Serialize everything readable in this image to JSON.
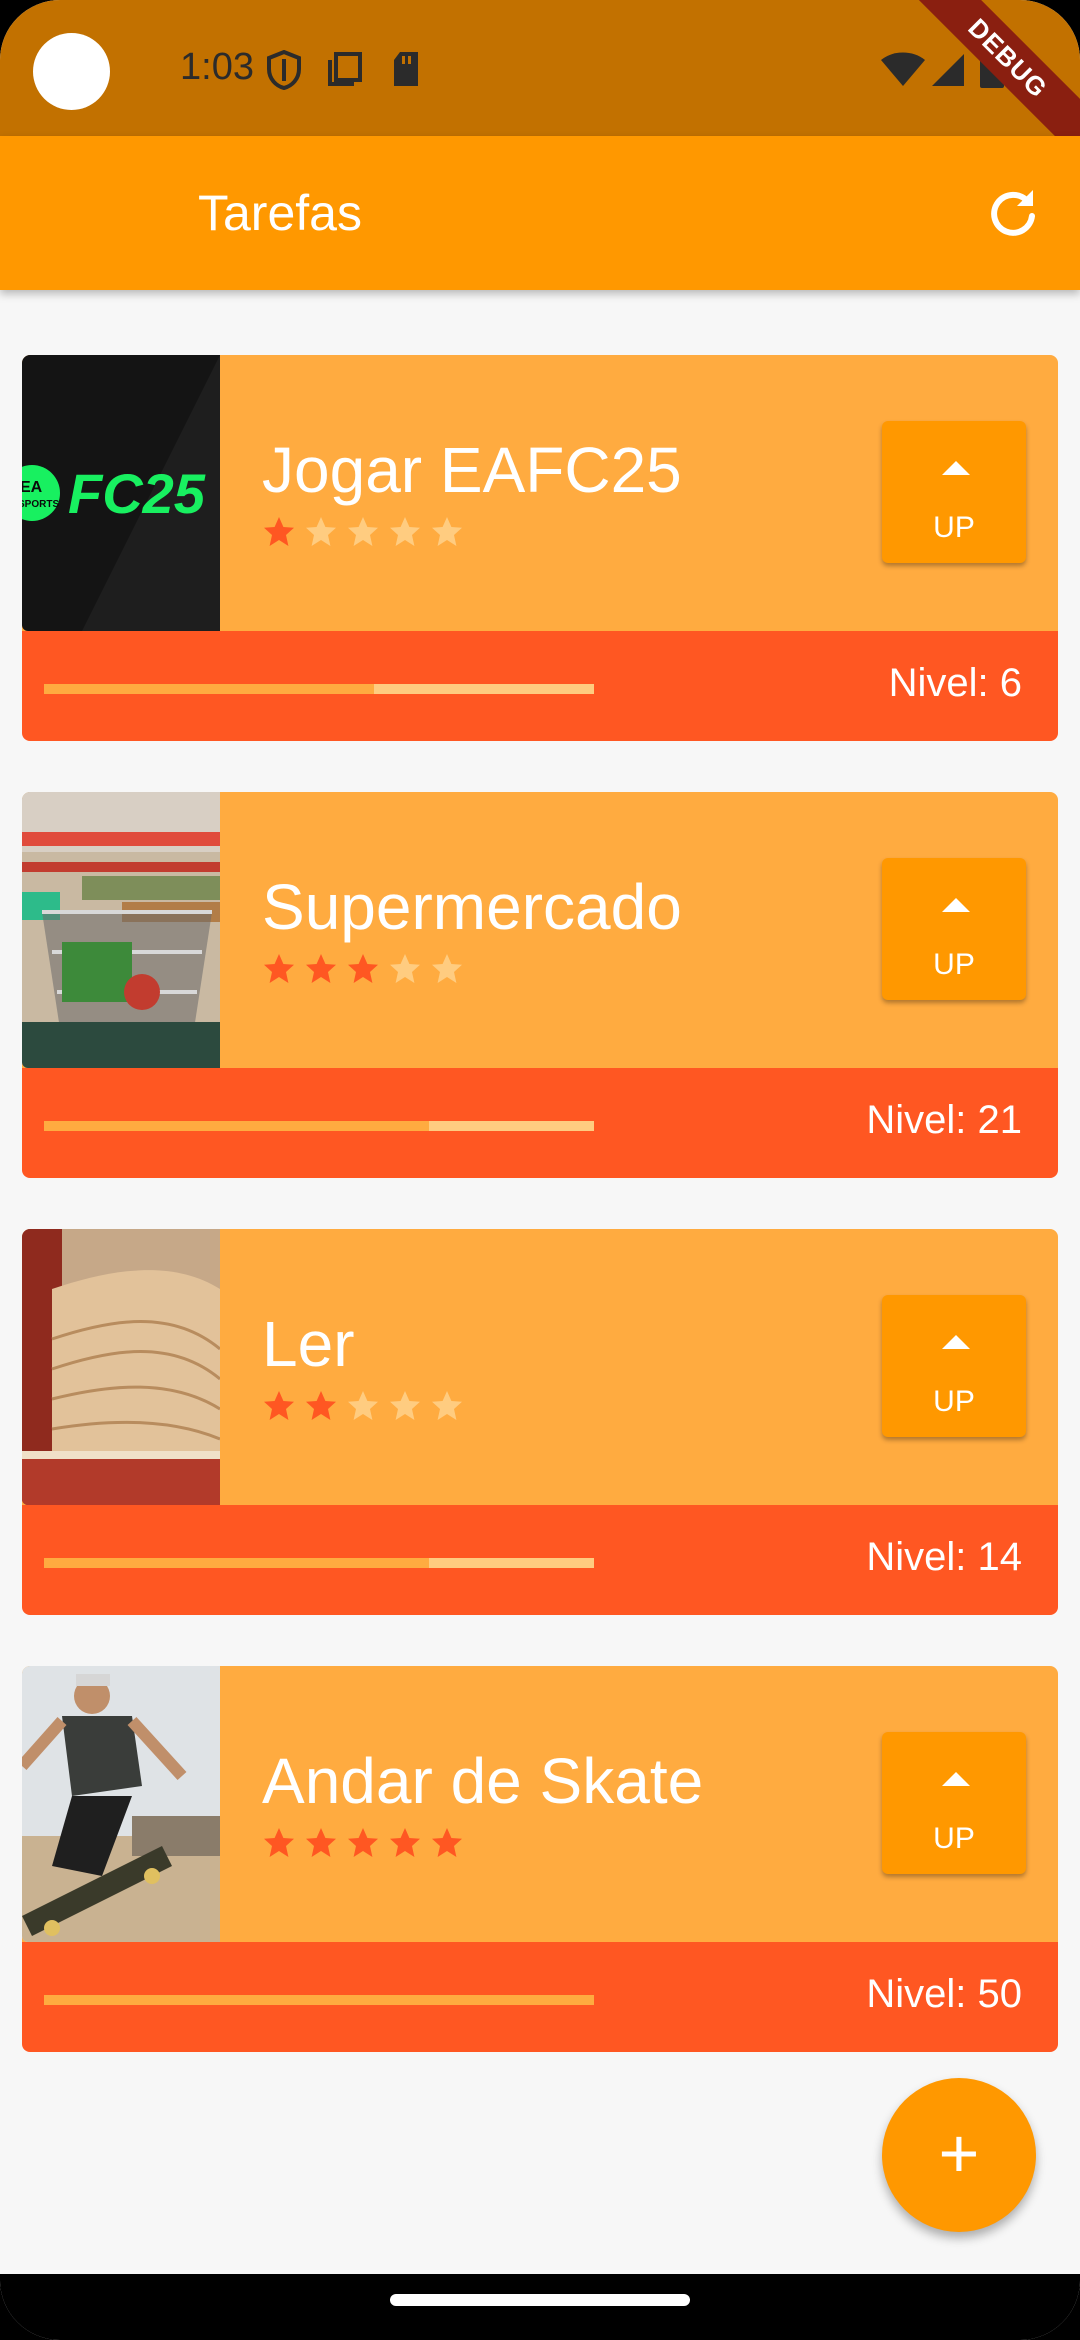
{
  "status_bar": {
    "time": "1:03",
    "debug_label": "DEBUG",
    "icons": [
      "shield-icon",
      "copy-icon",
      "sd-card-icon",
      "wifi-icon",
      "signal-icon",
      "battery-icon"
    ]
  },
  "app_bar": {
    "title": "Tarefas",
    "refresh_icon": "refresh-icon"
  },
  "tasks": [
    {
      "title": "Jogar EAFC25",
      "rating": 1,
      "level_text": "Nivel: 6",
      "progress": 0.6,
      "up_label": "UP",
      "image": "fc25-logo"
    },
    {
      "title": "Supermercado",
      "rating": 3,
      "level_text": "Nivel: 21",
      "progress": 0.7,
      "up_label": "UP",
      "image": "shopping-cart"
    },
    {
      "title": "Ler",
      "rating": 2,
      "level_text": "Nivel: 14",
      "progress": 0.7,
      "up_label": "UP",
      "image": "open-book"
    },
    {
      "title": "Andar de Skate",
      "rating": 5,
      "level_text": "Nivel: 50",
      "progress": 1.0,
      "up_label": "UP",
      "image": "skateboarder"
    }
  ],
  "fab": {
    "label": "+"
  },
  "colors": {
    "status_bar": "#c27100",
    "app_bar": "#ff9800",
    "card": "#ffab40",
    "card_footer": "#ff5722",
    "star_on": "#ff5722",
    "star_off": "#ffcc80"
  }
}
